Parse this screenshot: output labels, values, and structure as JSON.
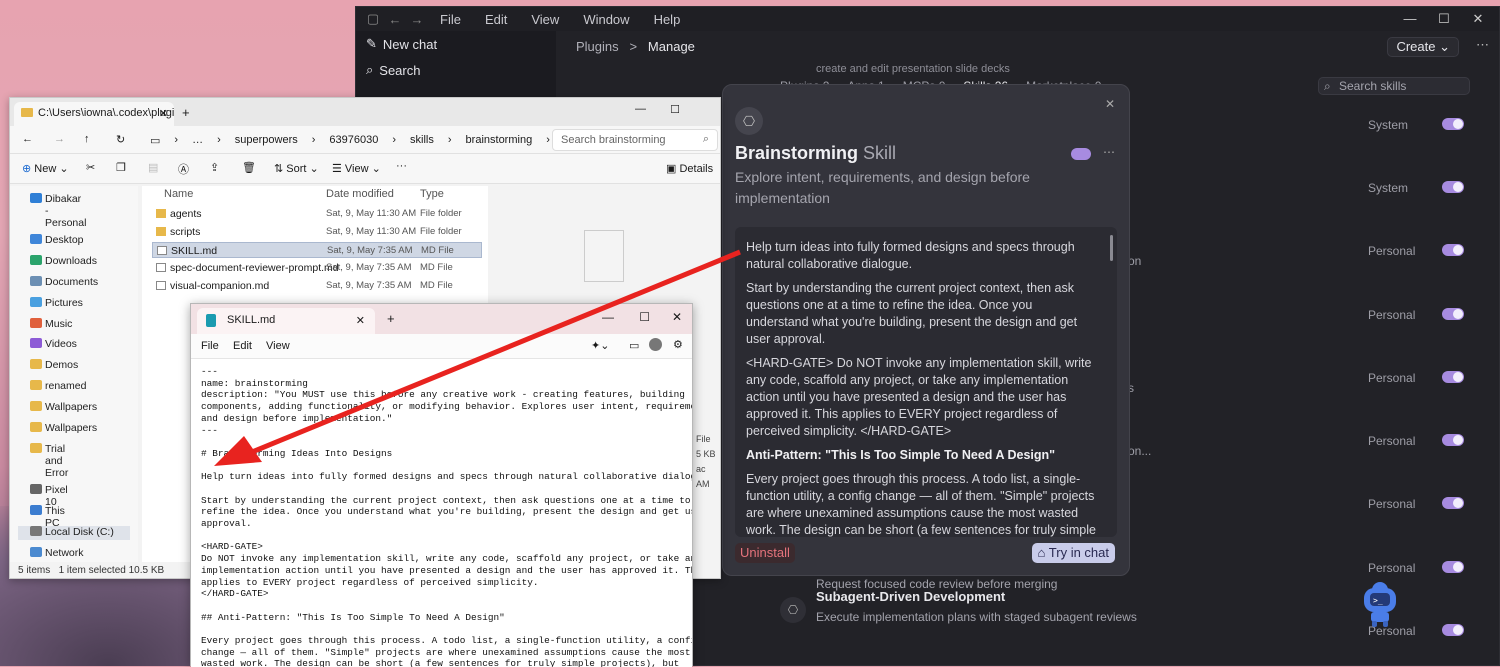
{
  "codex": {
    "menu": [
      "File",
      "Edit",
      "View",
      "Window",
      "Help"
    ],
    "sidebar": [
      {
        "label": "New chat",
        "icon": "compose-icon"
      },
      {
        "label": "Search",
        "icon": "search-icon"
      }
    ],
    "breadcrumb": {
      "parent": "Plugins",
      "sep": ">",
      "current": "Manage"
    },
    "create_label": "Create ⌄",
    "more": "⋯",
    "subtitle_partial": "create and edit presentation slide decks",
    "tabs": [
      "Plugins 2",
      "Apps 1",
      "MCPs 0",
      "Skills 26",
      "Marketplace 0"
    ],
    "search_placeholder": "Search skills",
    "scopes": [
      "System",
      "System",
      "Personal",
      "Personal",
      "Personal",
      "Personal",
      "Personal",
      "Personal",
      "Personal"
    ],
    "partial_texts": [
      "on",
      "s",
      "on..."
    ],
    "partial_row": "Request focused code review before merging",
    "skill_item": {
      "name": "Subagent-Driven Development",
      "desc": "Execute implementation plans with staged subagent reviews"
    }
  },
  "modal": {
    "title": "Brainstorming",
    "title_sub": "Skill",
    "description": "Explore intent, requirements, and design before implementation",
    "paragraphs": [
      "Help turn ideas into fully formed designs and specs through natural collaborative dialogue.",
      "Start by understanding the current project context, then ask questions one at a time to refine the idea. Once you understand what you're building, present the design and get user approval.",
      "<HARD-GATE> Do NOT invoke any implementation skill, write any code, scaffold any project, or take any implementation action until you have presented a design and the user has approved it. This applies to EVERY project regardless of perceived simplicity. </HARD-GATE>"
    ],
    "heading": "Anti-Pattern: \"This Is Too Simple To Need A Design\"",
    "paragraph_after": "Every project goes through this process. A todo list, a single-function utility, a config change — all of them. \"Simple\" projects are where unexamined assumptions cause the most wasted work. The design can be short (a few sentences for truly simple projects), but you MUST present it and get approval.",
    "uninstall_label": "Uninstall",
    "try_label": "Try in chat",
    "close": "✕",
    "more": "⋯"
  },
  "explorer": {
    "tab_title": "C:\\Users\\iowna\\.codex\\plugi",
    "breadcrumb": [
      "superpowers",
      "63976030",
      "skills",
      "brainstorming"
    ],
    "search_placeholder": "Search brainstorming",
    "cmd": {
      "new": "New",
      "sort": "Sort",
      "view": "View",
      "details": "Details"
    },
    "nav": [
      {
        "label": "Dibakar - Personal",
        "color": "#2f7fd6"
      },
      {
        "label": "Desktop",
        "color": "#3f86d9"
      },
      {
        "label": "Downloads",
        "color": "#2aa36b"
      },
      {
        "label": "Documents",
        "color": "#6c8fb3"
      },
      {
        "label": "Pictures",
        "color": "#4aa0e0"
      },
      {
        "label": "Music",
        "color": "#e0603c"
      },
      {
        "label": "Videos",
        "color": "#8d5bd6"
      },
      {
        "label": "Demos",
        "color": "#e7b84a"
      },
      {
        "label": "renamed",
        "color": "#e7b84a"
      },
      {
        "label": "Wallpapers",
        "color": "#e7b84a"
      },
      {
        "label": "Wallpapers",
        "color": "#e7b84a"
      },
      {
        "label": "Trial and Error",
        "color": "#e7b84a"
      },
      {
        "label": "Pixel 10",
        "color": "#666666"
      },
      {
        "label": "This PC",
        "color": "#3c7dd0"
      },
      {
        "label": "Local Disk (C:)",
        "color": "#777777"
      },
      {
        "label": "Network",
        "color": "#4b8ad0"
      }
    ],
    "columns": [
      "Name",
      "Date modified",
      "Type"
    ],
    "files": [
      {
        "name": "agents",
        "date": "Sat, 9, May 11:30 AM",
        "type": "File folder",
        "folder": true
      },
      {
        "name": "scripts",
        "date": "Sat, 9, May 11:30 AM",
        "type": "File folder",
        "folder": true
      },
      {
        "name": "SKILL.md",
        "date": "Sat, 9, May 7:35 AM",
        "type": "MD File",
        "folder": false
      },
      {
        "name": "spec-document-reviewer-prompt.md",
        "date": "Sat, 9, May 7:35 AM",
        "type": "MD File",
        "folder": false
      },
      {
        "name": "visual-companion.md",
        "date": "Sat, 9, May 7:35 AM",
        "type": "MD File",
        "folder": false
      }
    ],
    "details_partial": [
      "File",
      "5 KB",
      "ac",
      "AM"
    ],
    "status": {
      "items": "5 items",
      "selected": "1 item selected  10.5 KB"
    }
  },
  "notepad": {
    "tab_title": "SKILL.md",
    "menu": [
      "File",
      "Edit",
      "View"
    ],
    "lines": [
      "---",
      "name: brainstorming",
      "description: \"You MUST use this before any creative work - creating features, building",
      "components, adding functionality, or modifying behavior. Explores user intent, requirements",
      "and design before implementation.\"",
      "---",
      "",
      "# Brainstorming Ideas Into Designs",
      "",
      "Help turn ideas into fully formed designs and specs through natural collaborative dialogue.",
      "",
      "Start by understanding the current project context, then ask questions one at a time to",
      "refine the idea. Once you understand what you're building, present the design and get user",
      "approval.",
      "",
      "<HARD-GATE>",
      "Do NOT invoke any implementation skill, write any code, scaffold any project, or take any",
      "implementation action until you have presented a design and the user has approved it. This",
      "applies to EVERY project regardless of perceived simplicity.",
      "</HARD-GATE>",
      "",
      "## Anti-Pattern: \"This Is Too Simple To Need A Design\"",
      "",
      "Every project goes through this process. A todo list, a single-function utility, a config",
      "change — all of them. \"Simple\" projects are where unexamined assumptions cause the most",
      "wasted work. The design can be short (a few sentences for truly simple projects), but"
    ]
  },
  "colors": {
    "accent": "#a78be0",
    "arrow": "#e8231f",
    "danger": "#e5737c"
  }
}
